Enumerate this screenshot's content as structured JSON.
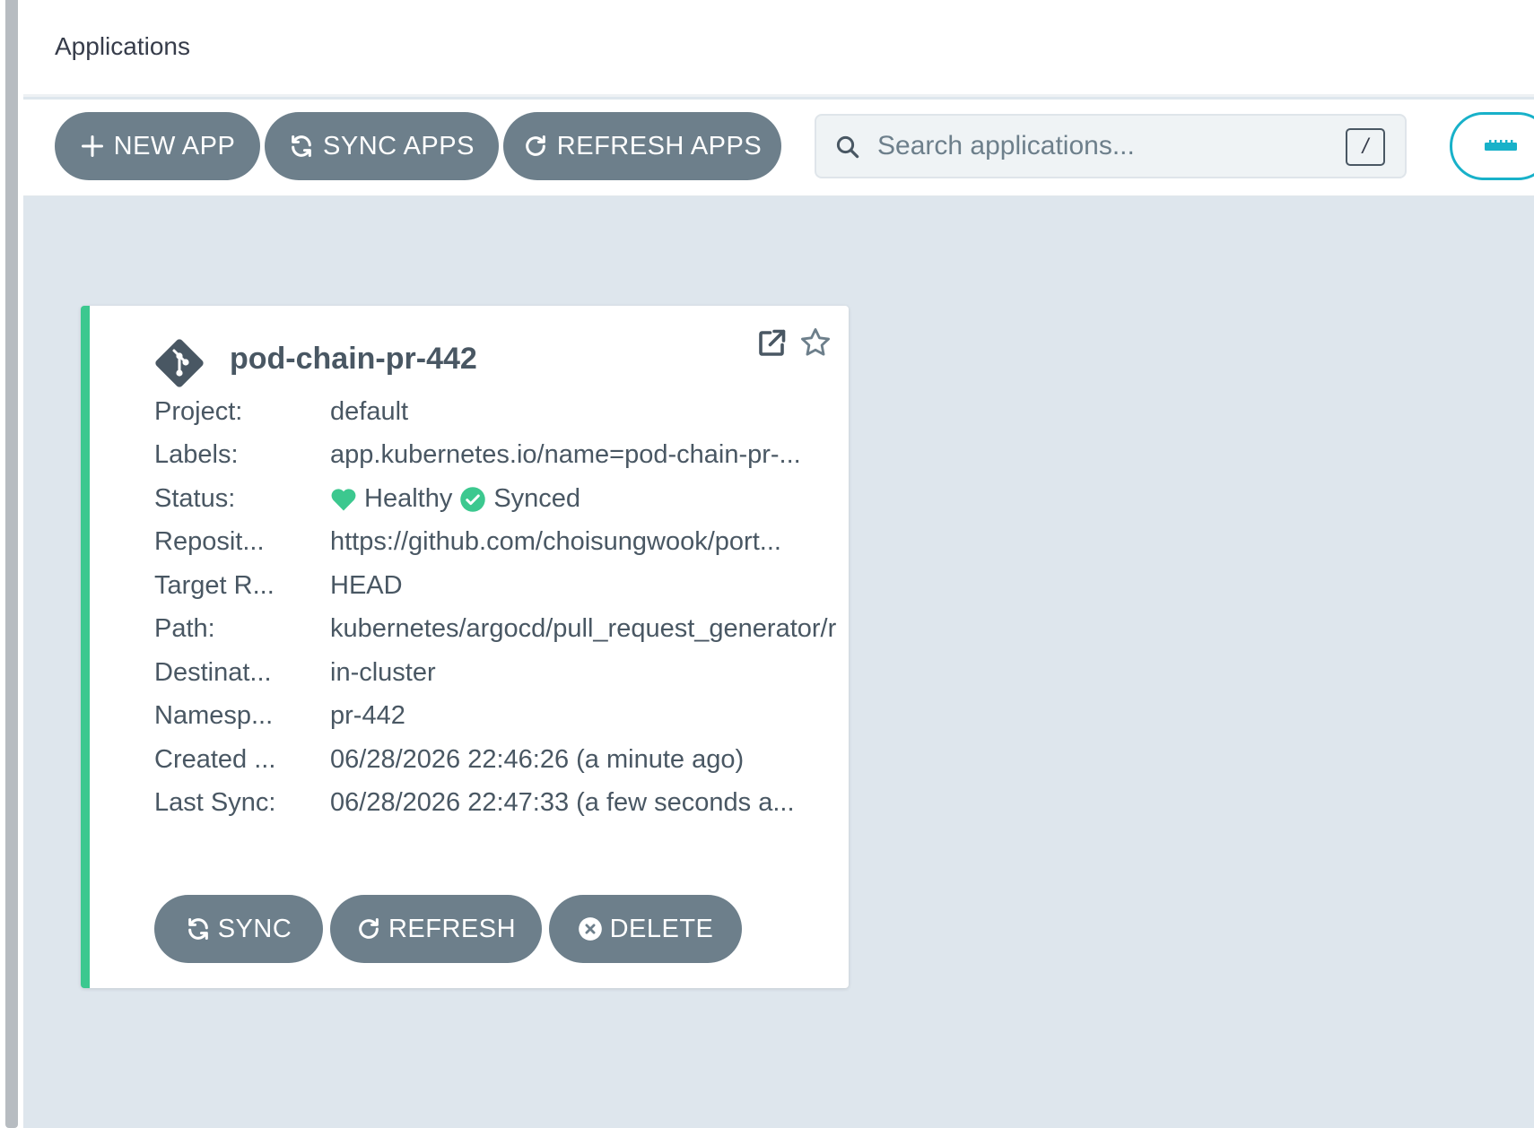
{
  "header": {
    "title": "Applications"
  },
  "toolbar": {
    "new_app": "NEW APP",
    "sync_apps": "SYNC APPS",
    "refresh_apps": "REFRESH APPS",
    "search_placeholder": "Search applications...",
    "search_value": "",
    "shortcut_key": "/",
    "view_toggle_icon": "tiles-view-icon"
  },
  "colors": {
    "button_bg": "#6d7f8b",
    "health_green": "#3cc88f",
    "accent_teal": "#18b1c9",
    "page_bg": "#dee6ed"
  },
  "app": {
    "name": "pod-chain-pr-442",
    "icon": "git-icon",
    "rows": [
      {
        "label": "Project:",
        "value": "default"
      },
      {
        "label": "Labels:",
        "value": "app.kubernetes.io/name=pod-chain-pr-..."
      },
      {
        "label": "Status:",
        "health": "Healthy",
        "sync": "Synced"
      },
      {
        "label": "Reposit...",
        "value": "https://github.com/choisungwook/port..."
      },
      {
        "label": "Target R...",
        "value": "HEAD"
      },
      {
        "label": "Path:",
        "value": "kubernetes/argocd/pull_request_generator/r"
      },
      {
        "label": "Destinat...",
        "value": "in-cluster"
      },
      {
        "label": "Namesp...",
        "value": "pr-442"
      },
      {
        "label": "Created ...",
        "value": "06/28/2026 22:46:26  (a minute ago)"
      },
      {
        "label": "Last Sync:",
        "value": "06/28/2026 22:47:33  (a few seconds a..."
      }
    ],
    "buttons": {
      "sync": "SYNC",
      "refresh": "REFRESH",
      "delete": "DELETE"
    }
  }
}
